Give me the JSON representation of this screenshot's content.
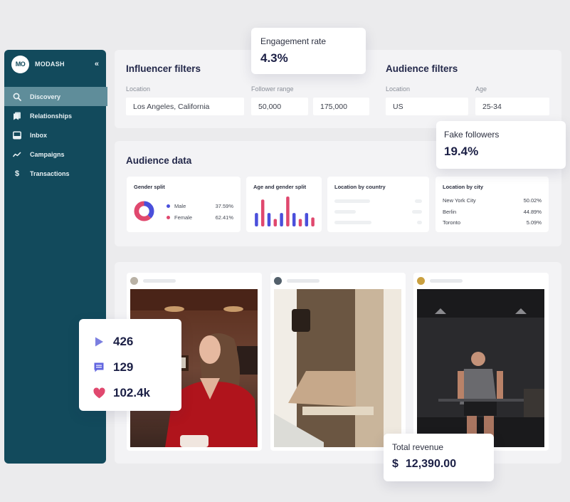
{
  "sidebar": {
    "brand": {
      "logo_text": "MO",
      "name": "MODASH",
      "collapse_icon": "double-chevron-left-icon",
      "collapse_glyph": "«"
    },
    "items": [
      {
        "label": "Discovery",
        "icon": "search-icon",
        "active": true
      },
      {
        "label": "Relationships",
        "icon": "bookmarks-icon",
        "active": false
      },
      {
        "label": "Inbox",
        "icon": "inbox-icon",
        "active": false
      },
      {
        "label": "Campaigns",
        "icon": "trend-line-icon",
        "active": false
      },
      {
        "label": "Transactions",
        "icon": "dollar-icon",
        "active": false
      }
    ]
  },
  "influencer_filters": {
    "title": "Influencer filters",
    "location_label": "Location",
    "location_value": "Los Angeles, California",
    "follower_range_label": "Follower range",
    "follower_min": "50,000",
    "follower_max": "175,000"
  },
  "audience_filters": {
    "title": "Audience filters",
    "location_label": "Location",
    "location_value": "US",
    "age_label": "Age",
    "age_value": "25-34"
  },
  "engagement_card": {
    "title": "Engagement rate",
    "value": "4.3%"
  },
  "fake_followers_card": {
    "title": "Fake followers",
    "value": "19.4%"
  },
  "audience_data": {
    "title": "Audience data",
    "gender_split": {
      "title": "Gender split",
      "items": [
        {
          "label": "Male",
          "value": "37.59%",
          "fraction": 0.3759,
          "color": "#4a4fdb"
        },
        {
          "label": "Female",
          "value": "62.41%",
          "fraction": 0.6241,
          "color": "#e0486e"
        }
      ]
    },
    "age_gender_split": {
      "title": "Age and gender split",
      "bars": [
        {
          "series": "male",
          "value": 0.45
        },
        {
          "series": "female",
          "value": 0.9
        },
        {
          "series": "male",
          "value": 0.45
        },
        {
          "series": "female",
          "value": 0.25
        },
        {
          "series": "male",
          "value": 0.45
        },
        {
          "series": "female",
          "value": 1.0
        },
        {
          "series": "male",
          "value": 0.45
        },
        {
          "series": "female",
          "value": 0.25
        },
        {
          "series": "male",
          "value": 0.45
        },
        {
          "series": "female",
          "value": 0.3
        }
      ],
      "colors": {
        "male": "#4a4fdb",
        "female": "#e0486e"
      }
    },
    "location_by_country": {
      "title": "Location by country",
      "rows": 3
    },
    "location_by_city": {
      "title": "Location by city",
      "rows": [
        {
          "city": "New York City",
          "value": "50.02%"
        },
        {
          "city": "Berlin",
          "value": "44.89%"
        },
        {
          "city": "Toronto",
          "value": "5.09%"
        }
      ]
    }
  },
  "post_stats_card": {
    "items": [
      {
        "icon": "play-icon",
        "value": "426",
        "color": "#7b7fe0"
      },
      {
        "icon": "comment-icon",
        "value": "129",
        "color": "#6266e0"
      },
      {
        "icon": "heart-icon",
        "value": "102.4k",
        "color": "#e0486e"
      }
    ]
  },
  "posts": [
    {
      "photo": "woman-in-red-cafe-photo",
      "avatar_color": "#b9b2a6"
    },
    {
      "photo": "chair-interior-photo",
      "avatar_color": "#53606b"
    },
    {
      "photo": "gym-athlete-photo",
      "avatar_color": "#caa040"
    }
  ],
  "revenue_card": {
    "title": "Total revenue",
    "currency": "$",
    "value": "12,390.00"
  }
}
